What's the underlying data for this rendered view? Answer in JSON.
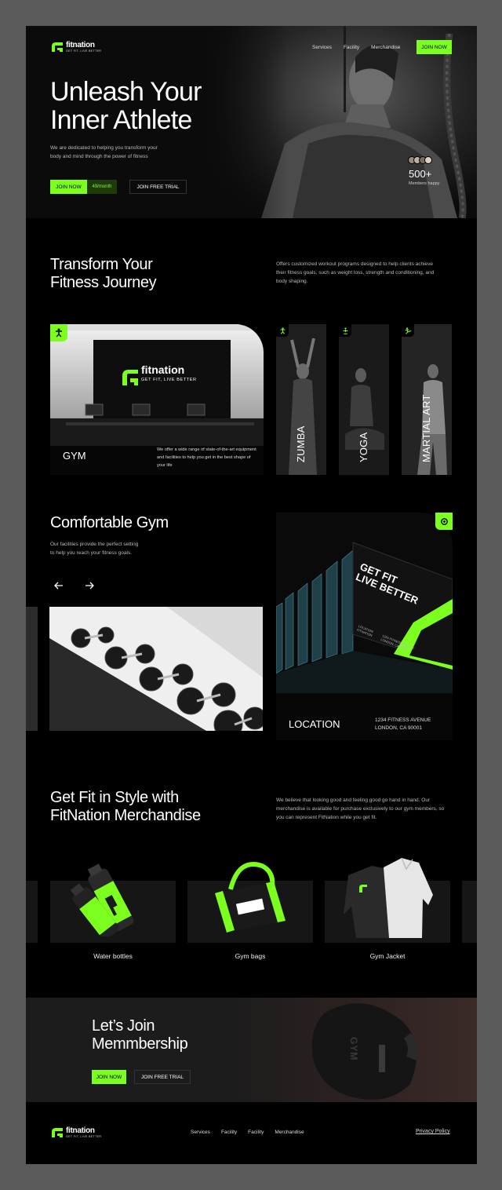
{
  "brand": {
    "name": "fitnation",
    "tagline": "GET FIT, LIVE BETTER",
    "accent": "#7cff1e"
  },
  "nav": {
    "items": [
      "Services",
      "Facility",
      "Merchandise"
    ],
    "cta": "JOIN NOW"
  },
  "hero": {
    "title_line1": "Unleash Your",
    "title_line2": "Inner Athlete",
    "subtitle_line1": "We are dedicated to helping you transform your",
    "subtitle_line2": "body and mind through the power of fitness",
    "join_label": "JOIN NOW",
    "price": "49/month",
    "trial_label": "JOIN FREE TRIAL",
    "members_count": "500+",
    "members_label": "Members happy"
  },
  "transform": {
    "title_line1": "Transform Your",
    "title_line2": "Fitness Journey",
    "description": "Offers customized workout programs designed to help clients achieve their fitness goals, such as weight loss, strength and conditioning, and body shaping."
  },
  "services": {
    "gym": {
      "label": "GYM",
      "description": "We offer a wide range of state-of-the-art equipment and facilities to help you get in the best shape of your life",
      "wall_brand": "fitnation",
      "wall_tagline": "GET FIT, LIVE BETTER"
    },
    "classes": [
      "ZUMBA",
      "YOGA",
      "MARTIAL ART"
    ]
  },
  "facility": {
    "title": "Comfortable Gym",
    "description_line1": "Our facilities provide the perfect setting",
    "description_line2": "to help you reach your fitness goals.",
    "prev_icon": "arrow-left-icon",
    "next_icon": "arrow-right-icon",
    "billboard_line1": "GET FIT",
    "billboard_line2": "LIVE BETTER",
    "billboard_small1": "LOCATION",
    "billboard_small2": "FITNATION",
    "billboard_small3": "1234 FITNESS AVENUE",
    "billboard_small4": "LONDON, CA 90001",
    "location_label": "LOCATION",
    "address_line1": "1234 FITNESS AVENUE",
    "address_line2": "LONDON, CA 90001"
  },
  "merch": {
    "title_line1": "Get Fit in Style with",
    "title_line2": "FitNation Merchandise",
    "description": "We believe that looking good and feeling good go hand in hand. Our merchandise is available for purchase exclusively to our gym members, so you can represent FitNation while you get fit.",
    "items": [
      "Water bottles",
      "Gym bags",
      "Gym Jacket"
    ]
  },
  "cta": {
    "title_line1": "Let’s Join",
    "title_line2": "Memmbership",
    "join_label": "JOIN NOW",
    "trial_label": "JOIN FREE TRIAL",
    "glove_text": "GYM"
  },
  "footer": {
    "links": [
      "Services",
      "Facility",
      "Facility",
      "Merchandise"
    ],
    "privacy": "Privacy Policy"
  }
}
